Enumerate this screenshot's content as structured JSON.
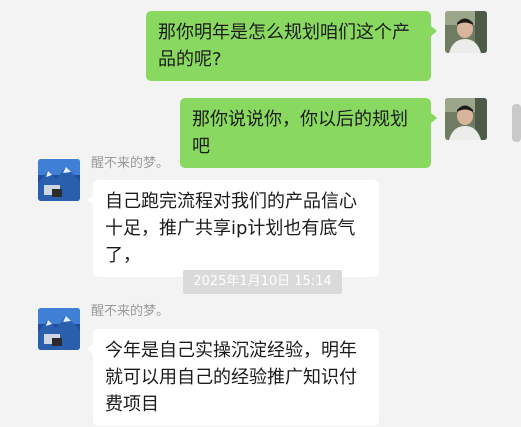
{
  "conversation": {
    "messages": [
      {
        "direction": "out",
        "text": "那你明年是怎么规划咱们这个产品的呢?"
      },
      {
        "direction": "out",
        "text": "那你说说你，你以后的规划吧"
      },
      {
        "direction": "in",
        "sender": "醒不来的梦。",
        "text": "自己跑完流程对我们的产品信心十足，推广共享ip计划也有底气了，"
      },
      {
        "direction": "in",
        "sender": "醒不来的梦。",
        "text": "今年是自己实操沉淀经验，明年就可以用自己的经验推广知识付费项目"
      }
    ],
    "timestamp": "2025年1月10日 15:14"
  },
  "colors": {
    "background": "#f3f3f3",
    "outgoing_bubble": "#89d961",
    "incoming_bubble": "#ffffff",
    "timestamp_bg": "#dadada"
  },
  "icons": {
    "self_avatar": "person-photo-avatar",
    "contact_avatar": "mountain-landscape-avatar"
  }
}
